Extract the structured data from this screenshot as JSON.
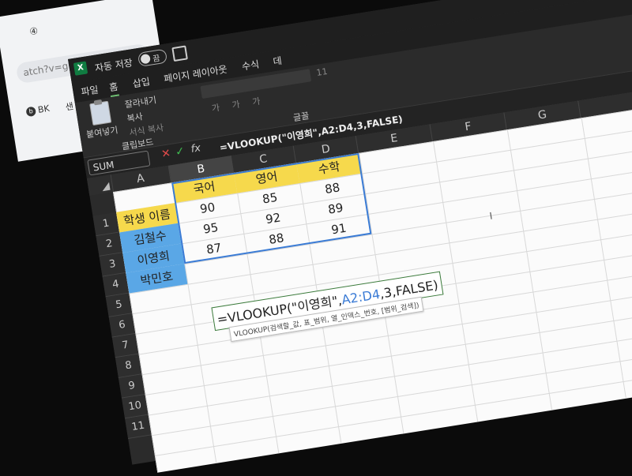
{
  "browser": {
    "tab_text": "④",
    "url_text": "atch?v=guEjAP0RP",
    "bookmarks": [
      "BK",
      "샌"
    ]
  },
  "titlebar": {
    "app_icon": "X",
    "autosave_label": "자동 저장",
    "autosave_state": "끔"
  },
  "menu": {
    "items": [
      "파일",
      "홈",
      "삽입",
      "페이지 레이아웃",
      "수식",
      "데"
    ],
    "active_index": 1
  },
  "ribbon": {
    "paste_label": "붙여넣기",
    "cut_label": "잘라내기",
    "copy_label": "복사",
    "format_painter_label": "서식 복사",
    "clipboard_group": "클립보드",
    "font_group": "글꼴",
    "font_size": "11",
    "font_buttons": [
      "가",
      "가",
      "가"
    ]
  },
  "formula_bar": {
    "name_box": "SUM",
    "formula": "=VLOOKUP(\"이영희\",A2:D4,3,FALSE)"
  },
  "grid": {
    "columns": [
      "A",
      "B",
      "C",
      "D",
      "E",
      "F",
      "G"
    ],
    "selected_column": "B",
    "rows": [
      "1",
      "2",
      "3",
      "4",
      "5",
      "6",
      "7",
      "8",
      "9",
      "10",
      "11"
    ],
    "cells": {
      "A1": "학생 이름",
      "B1": "국어",
      "C1": "영어",
      "D1": "수학",
      "A2": "김철수",
      "B2": "90",
      "C2": "85",
      "D2": "88",
      "A3": "이영희",
      "B3": "95",
      "C3": "92",
      "D3": "89",
      "A4": "박민호",
      "B4": "87",
      "C4": "88",
      "D4": "91"
    }
  },
  "editing": {
    "formula_prefix": "=VLOOKUP(\"이영희\",",
    "formula_ref": "A2:D4",
    "formula_suffix": ",3,FALSE)",
    "tooltip": "VLOOKUP(검색할_값, 표_범위, 열_인덱스_번호, [범위_검색])"
  },
  "colors": {
    "header_yellow": "#f6d94c",
    "name_blue": "#5aa7e6",
    "range_blue": "#3a7bd5",
    "excel_green": "#107c41"
  }
}
